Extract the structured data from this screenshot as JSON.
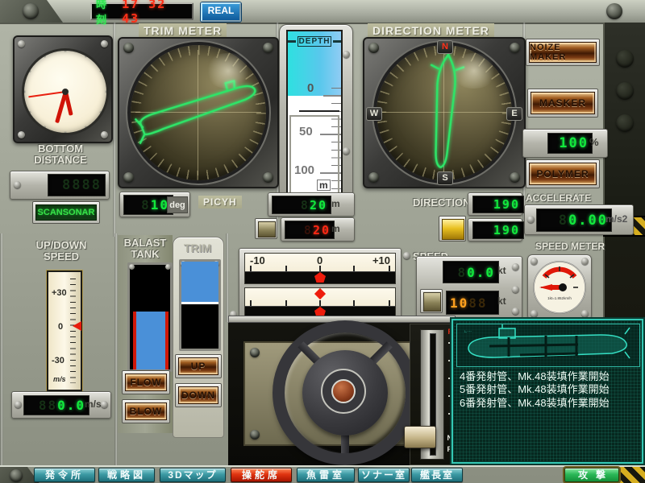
{
  "top_bar": {
    "clock_label": "時刻",
    "time_digits": "17 32 43",
    "real_label": "REAL"
  },
  "meters": {
    "trim_label": "TRIM METER",
    "direction_label": "DIRECTION METER",
    "speed_meter_label": "SPEED METER",
    "speed_meter_note": "1kt=1.852km/h",
    "compass": {
      "n": "N",
      "e": "E",
      "s": "S",
      "w": "W"
    }
  },
  "depth_gauge": {
    "title": "DEPTH",
    "tick0": "0",
    "tick50": "50",
    "tick100": "100",
    "unit": "m"
  },
  "bottom_distance": {
    "label1": "BOTTOM",
    "label2": "DISTANCE",
    "value_dim": "8888",
    "button": "SCANSONAR"
  },
  "pitch": {
    "dim": "8",
    "value": "10",
    "unit": "deg",
    "label": "PICYH"
  },
  "depth_readouts": {
    "target": {
      "dim": "8",
      "value": "20",
      "unit": "m"
    },
    "current": {
      "dim": "8",
      "value": "20",
      "unit": "m"
    }
  },
  "direction_readouts": {
    "label": "DIRECTION",
    "ordered": "190",
    "current": "190"
  },
  "accelerate": {
    "label": "ACCELERATE",
    "dim": "8",
    "value": "0.00",
    "unit": "m/s2"
  },
  "masker_charge": {
    "value": "100",
    "unit": "%"
  },
  "side_buttons": {
    "noize_maker": "NOIZE MAKER",
    "masker": "MASKER",
    "polymer": "POLYMER"
  },
  "updown": {
    "label1": "UP/DOWN",
    "label2": "SPEED",
    "scale_plus": "+30",
    "scale_zero": "0",
    "scale_minus": "-30",
    "scale_unit": "m/s",
    "dim": "88",
    "value": "0.0",
    "unit": "m/s"
  },
  "ballast": {
    "label1": "BALAST",
    "label2": "TANK",
    "flow": "FLOW",
    "blow": "BLOW"
  },
  "trim_ctrl": {
    "label": "TRIM",
    "up": "UP",
    "down": "DOWN"
  },
  "rudder_scale": {
    "minus": "-10",
    "zero": "0",
    "plus": "+10"
  },
  "speed": {
    "label": "SPEED",
    "green": {
      "dim": "8",
      "value": "0.0",
      "unit": "kt"
    },
    "orange": {
      "value": "10",
      "dim": "88",
      "unit": "kt"
    }
  },
  "throttle": {
    "f": "F",
    "n": "N",
    "r": "R"
  },
  "messages": {
    "0": "4番発射管、Mk.48装填作業開始",
    "1": "5番発射管、Mk.48装填作業開始",
    "2": "6番発射管、Mk.48装填作業開始"
  },
  "nav": {
    "items": {
      "0": {
        "label": "発令所"
      },
      "1": {
        "label": "戦略図"
      },
      "2": {
        "label": "3Dマップ"
      },
      "3": {
        "label": "操舵席"
      },
      "4": {
        "label": "魚雷室"
      },
      "5": {
        "label": "ソナー室"
      },
      "6": {
        "label": "艦長室"
      }
    },
    "attack": "攻撃"
  }
}
